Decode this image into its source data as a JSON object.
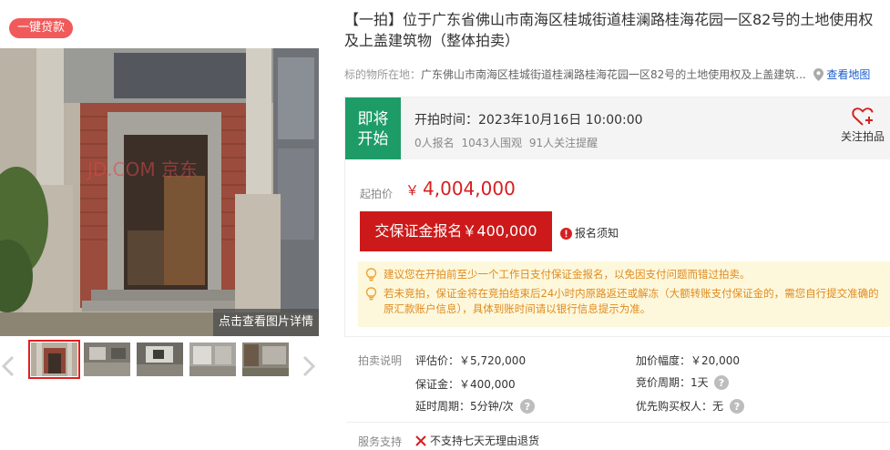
{
  "gallery": {
    "badge": "一键贷款",
    "detail_button": "点击查看图片详情",
    "watermark": "JD.COM 京东",
    "thumbnails": [
      "thumb-1",
      "thumb-2",
      "thumb-3",
      "thumb-4",
      "thumb-5"
    ],
    "active_thumbnail_index": 0
  },
  "title": "【一拍】位于广东省佛山市南海区桂城街道桂澜路桂海花园一区82号的土地使用权及上盖建筑物（整体拍卖）",
  "location": {
    "label": "标的物所在地：",
    "address": "广东佛山市南海区桂城街道桂澜路桂海花园一区82号的土地使用权及上盖建筑...",
    "map_link": "查看地图"
  },
  "auction": {
    "status": "即将开始",
    "start_time": "开拍时间：2023年10月16日 10:00:00",
    "stats": {
      "registered": "0人报名",
      "watchers": "1043人围观",
      "reminders": "91人关注提醒"
    },
    "follow_label": "关注拍品",
    "start_price_label": "起拍价",
    "currency": "￥",
    "start_price": "4,004,000",
    "deposit_button": "交保证金报名￥400,000",
    "notice_link": "报名须知",
    "tips": [
      "建议您在开拍前至少一个工作日支付保证金报名，以免因支付问题而错过拍卖。",
      "若未竞拍，保证金将在竞拍结束后24小时内原路返还或解冻（大额转账支付保证金的，需您自行提交准确的原汇款账户信息），具体到账时间请以银行信息提示为准。"
    ]
  },
  "description": {
    "label": "拍卖说明",
    "appraisal": "评估价：￥5,720,000",
    "increment": "加价幅度：￥20,000",
    "deposit": "保证金：￥400,000",
    "bid_period": "竞价周期：1天",
    "extension": "延时周期：5分钟/次",
    "priority": "优先购买权人：无"
  },
  "service": {
    "label": "服务支持",
    "no_return": "不支持七天无理由退货"
  },
  "colors": {
    "accent_red": "#cc1a1a",
    "status_green": "#1e9c68",
    "tip_orange": "#e08a1e",
    "link_blue": "#1a5ccf"
  }
}
